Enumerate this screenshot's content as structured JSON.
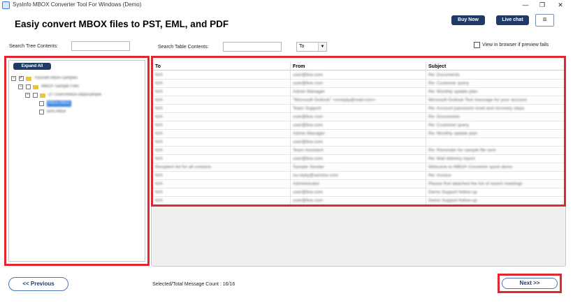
{
  "window": {
    "title": "SysInfo MBOX Converter Tool For Windows (Demo)",
    "min": "—",
    "max": "❐",
    "close": "✕"
  },
  "header": {
    "headline": "Easiy convert MBOX files to PST, EML, and PDF",
    "buy_now": "Buy Now",
    "live_chat": "Live chat",
    "menu": "≡"
  },
  "search": {
    "tree_label": "Search Tree Contents:",
    "table_label": "Search Table Contents:",
    "field_select": "To",
    "preview_label": "View in browser if preview fails"
  },
  "tree": {
    "expand_all": "Expand All",
    "nodes": [
      {
        "label": "Yourself.mbox-samples",
        "level": 0
      },
      {
        "label": "MBOX Sample Files",
        "level": 1
      },
      {
        "label": "D:\\ Users\\mbox-data\\sample",
        "level": 2
      },
      {
        "label": "Inbox.mbox",
        "level": 3,
        "selected": true
      },
      {
        "label": "sent.mbox",
        "level": 3
      }
    ]
  },
  "table": {
    "columns": [
      "To",
      "From",
      "Subject"
    ],
    "rows": [
      [
        "N/A",
        "user@live.com",
        "Re: Documents"
      ],
      [
        "N/A",
        "user@live.com",
        "Re: Customer query"
      ],
      [
        "N/A",
        "Admin Manager",
        "Re: Monthly update plan"
      ],
      [
        "N/A",
        "\"Microsoft Outlook\" <noreply@mail.com>",
        "Microsoft Outlook Test message for your account"
      ],
      [
        "N/A",
        "Team Support",
        "Re: Account password reset and recovery steps"
      ],
      [
        "N/A",
        "user@live.com",
        "Re: Documents"
      ],
      [
        "N/A",
        "user@live.com",
        "Re: Customer query"
      ],
      [
        "N/A",
        "Admin Manager",
        "Re: Monthly update plan"
      ],
      [
        "N/A",
        "user@live.com",
        ""
      ],
      [
        "N/A",
        "Team Assistant",
        "Re: Reminder for sample file sent"
      ],
      [
        "N/A",
        "user@live.com",
        "Re: Mail delivery report"
      ],
      [
        "Recipient list for all contacts",
        "Sample Sender",
        "Welcome to MBOX Converter quick demo"
      ],
      [
        "N/A",
        "no-reply@service.com",
        "Re: Invoice"
      ],
      [
        "N/A",
        "Administrator",
        "Please find attached the list of recent meetings"
      ],
      [
        "N/A",
        "user@live.com",
        "Demo Support follow-up"
      ],
      [
        "N/A",
        "user@live.com",
        "Demo Support follow-up"
      ]
    ]
  },
  "footer": {
    "previous": "<< Previous",
    "status": "Selected/Total Message Count : 16/16",
    "next": "Next >>"
  }
}
